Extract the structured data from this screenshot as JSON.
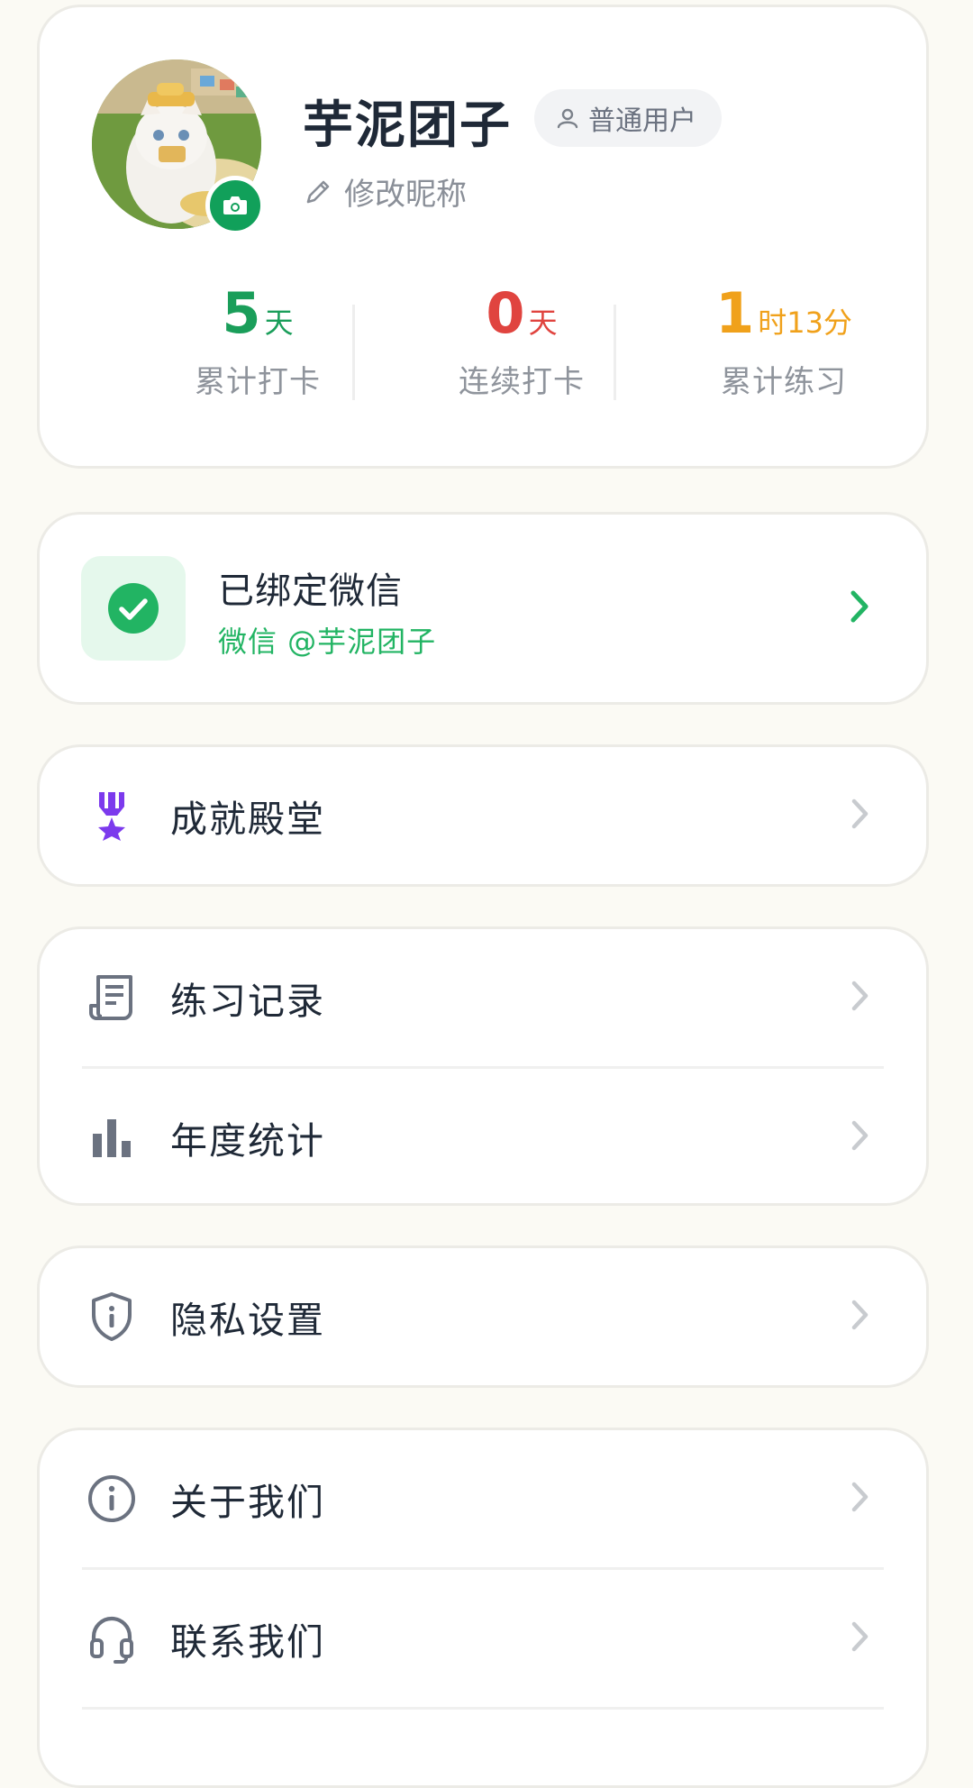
{
  "profile": {
    "nickname": "芋泥团子",
    "role_badge": "普通用户",
    "edit_nickname": "修改昵称",
    "stats": [
      {
        "value": "5",
        "unit": "天",
        "label": "累计打卡",
        "color": "#1a9e5a"
      },
      {
        "value": "0",
        "unit": "天",
        "label": "连续打卡",
        "color": "#e0443f"
      },
      {
        "value": "1",
        "unit": "时13分",
        "label": "累计练习",
        "color": "#f0a11b"
      }
    ]
  },
  "wechat": {
    "title": "已绑定微信",
    "subtitle": "微信 @芋泥团子",
    "accent_color": "#22b463"
  },
  "menu": {
    "achievement": {
      "label": "成就殿堂",
      "icon": "medal-icon",
      "icon_color": "#7c3aed"
    },
    "records": {
      "label": "练习记录",
      "icon": "receipt-icon"
    },
    "yearly_stats": {
      "label": "年度统计",
      "icon": "bar-chart-icon"
    },
    "privacy": {
      "label": "隐私设置",
      "icon": "shield-icon"
    },
    "about": {
      "label": "关于我们",
      "icon": "info-icon"
    },
    "contact": {
      "label": "联系我们",
      "icon": "headset-icon"
    }
  }
}
